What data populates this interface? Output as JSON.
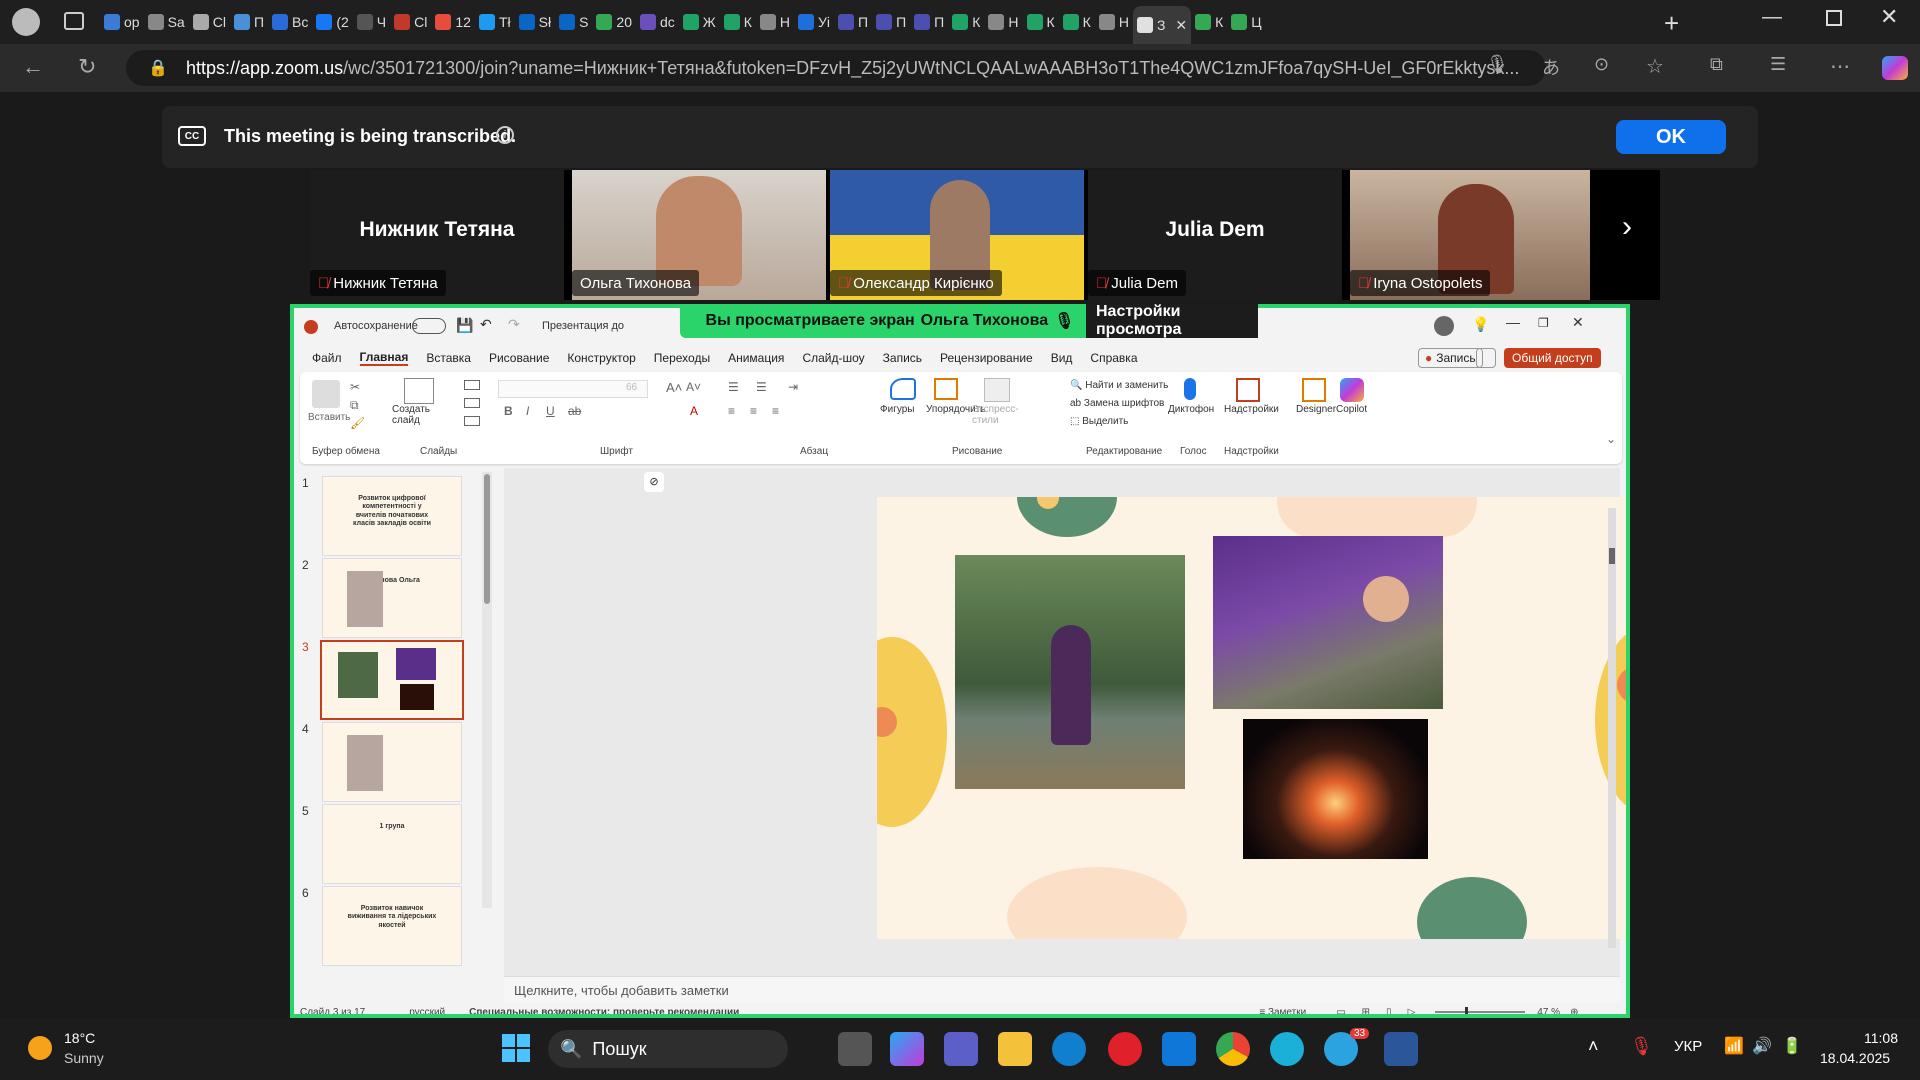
{
  "browser": {
    "tabs": [
      "ор",
      "Sa",
      "Cl",
      "П",
      "Вс",
      "(2",
      "Ч",
      "Cl",
      "12",
      "Tł",
      "Sł",
      "S",
      "20",
      "dc",
      "Ж",
      "К",
      "Н",
      "Уі",
      "П",
      "П",
      "П",
      "К",
      "Н",
      "К",
      "К",
      "Н",
      "З",
      "К",
      "Ц"
    ],
    "url_host": "https://app.zoom.us",
    "url_path": "/wc/3501721300/join?uname=Нижник+Тетяна&futoken=DFzvH_Z5j2yUWtNCLQAALwAAABH3oT1The4QWC1zmJFfoa7qySH-UeI_GF0rEkktysk..."
  },
  "banner": {
    "text": "This meeting is being transcribed.",
    "ok": "OK"
  },
  "participants": [
    {
      "name": "Нижник Тетяна",
      "big": "Нижник Тетяна",
      "muted": true,
      "video": false
    },
    {
      "name": "Ольга Тихонова",
      "muted": false,
      "video": true
    },
    {
      "name": "Олександр Кирієнко",
      "muted": true,
      "video": true
    },
    {
      "name": "Julia Dem",
      "big": "Julia Dem",
      "muted": true,
      "video": false
    },
    {
      "name": "Iryna Ostopolets",
      "muted": true,
      "video": true
    }
  ],
  "share": {
    "viewing": "Вы просматриваете экран",
    "presenter": "Ольга Тихонова",
    "view_options": "Настройки просмотра"
  },
  "ppt": {
    "autosave": "Автосохранение",
    "doc_title": "Презентация до",
    "menu": [
      "Файл",
      "Главная",
      "Вставка",
      "Рисование",
      "Конструктор",
      "Переходы",
      "Анимация",
      "Слайд-шоу",
      "Запись",
      "Рецензирование",
      "Вид",
      "Справка"
    ],
    "record": "Запись",
    "share_btn": "Общий доступ",
    "ribbon": {
      "paste": "Вставить",
      "clipboard": "Буфер обмена",
      "new_slide": "Создать слайд",
      "slides": "Слайды",
      "font_size": "66",
      "font": "Шрифт",
      "paragraph": "Абзац",
      "shapes": "Фигуры",
      "arrange": "Упорядочить",
      "quick_styles": "Экспресс-стили",
      "drawing": "Рисование",
      "find_replace": "Найти и заменить",
      "replace_fonts": "Замена шрифтов",
      "select": "Выделить",
      "editing": "Редактирование",
      "dictate": "Диктофон",
      "voice": "Голос",
      "addins": "Надстройки",
      "addins_group": "Надстройки",
      "designer": "Designer",
      "copilot": "Copilot"
    },
    "thumbnails": [
      {
        "num": "1",
        "title": "Розвиток цифрової компетентності у вчителів початкових класів закладів освіти"
      },
      {
        "num": "2",
        "title": "Тихонова Ольга"
      },
      {
        "num": "3",
        "title": ""
      },
      {
        "num": "4",
        "title": ""
      },
      {
        "num": "5",
        "title": "1 група"
      },
      {
        "num": "6",
        "title": "Розвиток навичок виживання та лідерських якостей"
      }
    ],
    "notes_placeholder": "Щелкните, чтобы добавить заметки",
    "status": {
      "slide": "Слайд 3 из 17",
      "lang": "русский",
      "accessibility": "Специальные возможности: проверьте рекомендации",
      "notes": "Заметки",
      "zoom": "47 %"
    }
  },
  "taskbar": {
    "weather_temp": "18°C",
    "weather_desc": "Sunny",
    "search": "Пошук",
    "lang": "УКР",
    "time": "11:08",
    "date": "18.04.2025",
    "telegram_badge": "33"
  },
  "colors": {
    "share_border": "#2bd46a",
    "zoom_blue": "#0e71eb",
    "ppt_red": "#c43e1c"
  }
}
